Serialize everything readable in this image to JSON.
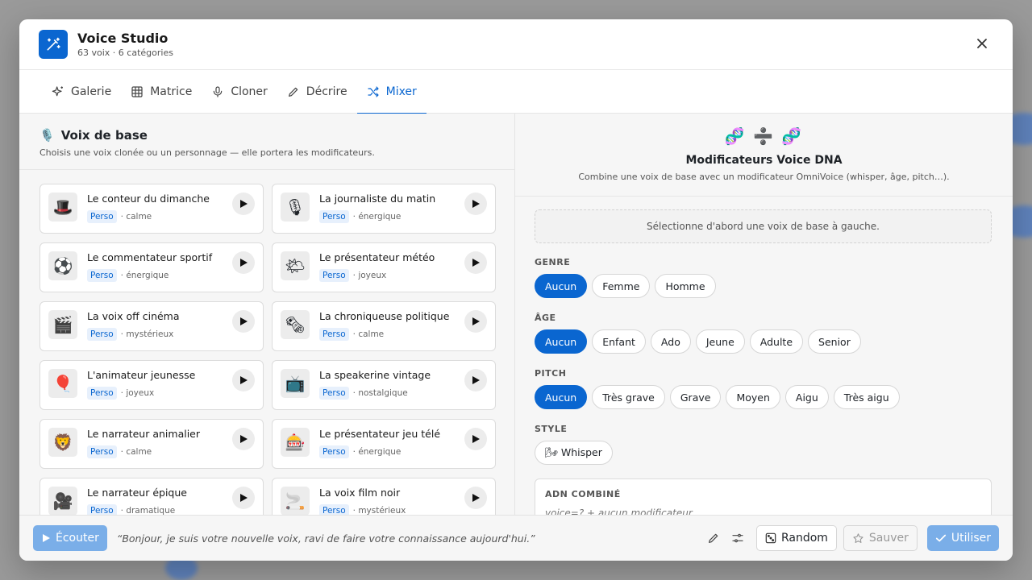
{
  "app": {
    "title": "Voice Studio",
    "subtitle": "63 voix · 6 catégories"
  },
  "tabs": [
    {
      "label": "Galerie",
      "icon": "sparkles-icon"
    },
    {
      "label": "Matrice",
      "icon": "grid-icon"
    },
    {
      "label": "Cloner",
      "icon": "mic-icon"
    },
    {
      "label": "Décrire",
      "icon": "pencil-icon"
    },
    {
      "label": "Mixer",
      "icon": "shuffle-icon",
      "active": true
    }
  ],
  "left": {
    "icon": "🎙️",
    "title": "Voix de base",
    "description": "Choisis une voix clonée ou un personnage — elle portera les modificateurs.",
    "voices": [
      {
        "emoji": "🎩",
        "name": "Le conteur du dimanche",
        "badge": "Perso",
        "mood": "· calme"
      },
      {
        "emoji": "🎙",
        "name": "La journaliste du matin",
        "badge": "Perso",
        "mood": "· énergique"
      },
      {
        "emoji": "⚽",
        "name": "Le commentateur sportif",
        "badge": "Perso",
        "mood": "· énergique"
      },
      {
        "emoji": "🌤",
        "name": "Le présentateur météo",
        "badge": "Perso",
        "mood": "· joyeux"
      },
      {
        "emoji": "🎬",
        "name": "La voix off cinéma",
        "badge": "Perso",
        "mood": "· mystérieux"
      },
      {
        "emoji": "🗞",
        "name": "La chroniqueuse politique",
        "badge": "Perso",
        "mood": "· calme"
      },
      {
        "emoji": "🎈",
        "name": "L'animateur jeunesse",
        "badge": "Perso",
        "mood": "· joyeux"
      },
      {
        "emoji": "📺",
        "name": "La speakerine vintage",
        "badge": "Perso",
        "mood": "· nostalgique"
      },
      {
        "emoji": "🦁",
        "name": "Le narrateur animalier",
        "badge": "Perso",
        "mood": "· calme"
      },
      {
        "emoji": "🎰",
        "name": "Le présentateur jeu télé",
        "badge": "Perso",
        "mood": "· énergique"
      },
      {
        "emoji": "🎥",
        "name": "Le narrateur épique",
        "badge": "Perso",
        "mood": "· dramatique"
      },
      {
        "emoji": "🚬",
        "name": "La voix film noir",
        "badge": "Perso",
        "mood": "· mystérieux"
      }
    ]
  },
  "right": {
    "icons": "🧬 ➗ 🧬",
    "title": "Modificateurs Voice DNA",
    "description": "Combine une voix de base avec un modificateur OmniVoice (whisper, âge, pitch…).",
    "notice": "Sélectionne d'abord une voix de base à gauche.",
    "sections": [
      {
        "label": "GENRE",
        "options": [
          "Aucun",
          "Femme",
          "Homme"
        ],
        "selected": 0
      },
      {
        "label": "ÂGE",
        "options": [
          "Aucun",
          "Enfant",
          "Ado",
          "Jeune",
          "Adulte",
          "Senior"
        ],
        "selected": 0
      },
      {
        "label": "PITCH",
        "options": [
          "Aucun",
          "Très grave",
          "Grave",
          "Moyen",
          "Aigu",
          "Très aigu"
        ],
        "selected": 0
      },
      {
        "label": "STYLE",
        "options": [
          "🌬 Whisper"
        ],
        "selected": -1
      }
    ],
    "combined": {
      "label": "ADN COMBINÉ",
      "value": "voice=? + aucun modificateur"
    }
  },
  "footer": {
    "listen_label": "Écouter",
    "quote": "“Bonjour, je suis votre nouvelle voix, ravi de faire votre connaissance aujourd'hui.”",
    "random_label": "Random",
    "save_label": "Sauver",
    "use_label": "Utiliser"
  },
  "colors": {
    "accent": "#0a66d0",
    "accent_disabled": "#7aaee8",
    "badge_bg": "#e7f0fc"
  }
}
